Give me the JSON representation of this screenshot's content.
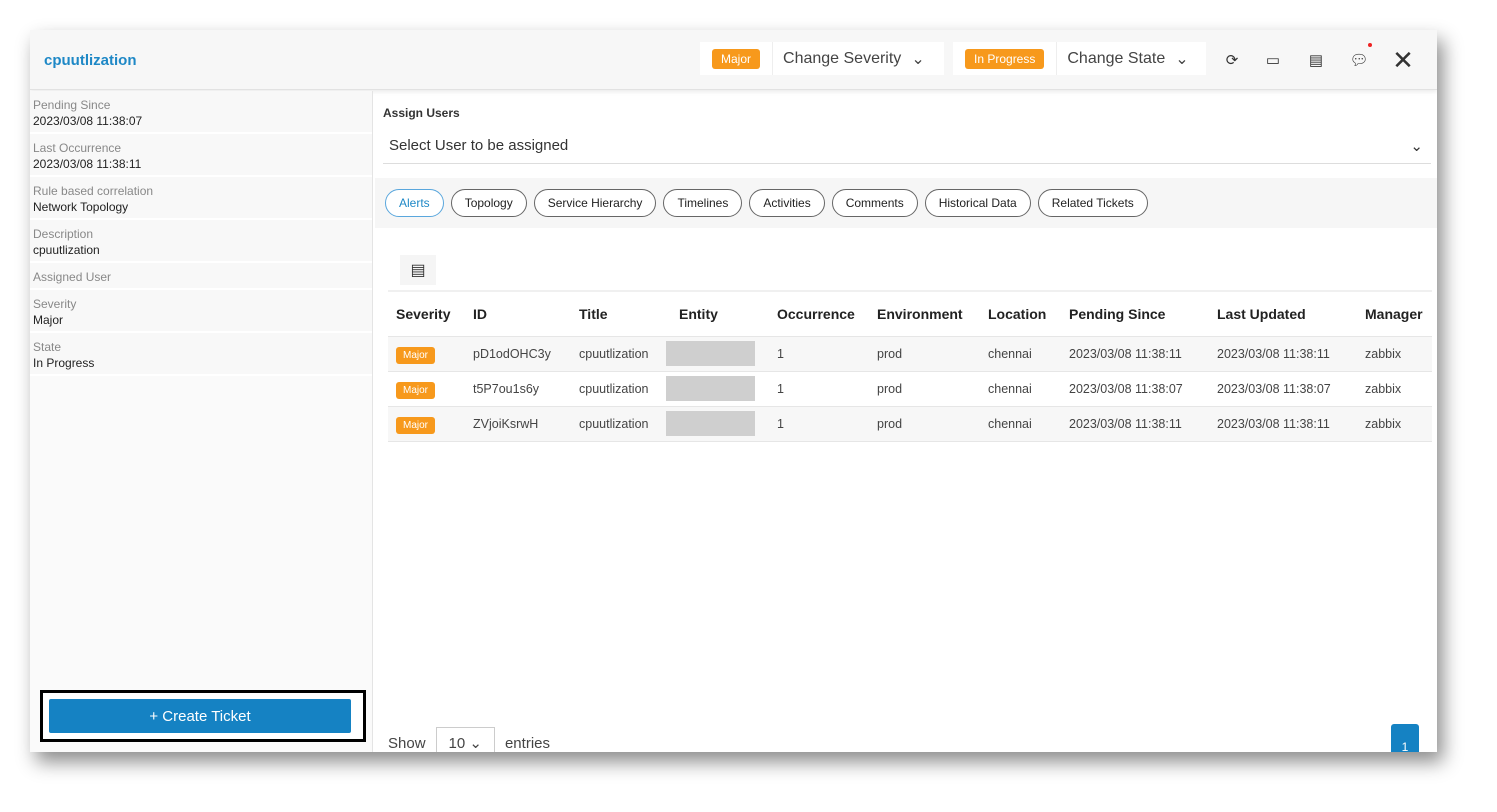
{
  "header": {
    "title": "cpuutlization",
    "severity_badge": "Major",
    "change_severity": "Change Severity",
    "state_badge": "In Progress",
    "change_state": "Change State"
  },
  "sidebar": {
    "fields": [
      {
        "label": "Pending Since",
        "value": "2023/03/08 11:38:07"
      },
      {
        "label": "Last Occurrence",
        "value": "2023/03/08 11:38:11"
      },
      {
        "label": "Rule based correlation",
        "value": "Network Topology"
      },
      {
        "label": "Description",
        "value": "cpuutlization"
      },
      {
        "label": "Assigned User",
        "value": ""
      },
      {
        "label": "Severity",
        "value": "Major"
      },
      {
        "label": "State",
        "value": "In Progress"
      }
    ],
    "create_ticket": "+ Create Ticket"
  },
  "assign": {
    "label": "Assign Users",
    "placeholder": "Select User to be assigned"
  },
  "tabs": [
    "Alerts",
    "Topology",
    "Service Hierarchy",
    "Timelines",
    "Activities",
    "Comments",
    "Historical Data",
    "Related Tickets"
  ],
  "table": {
    "columns": [
      "Severity",
      "ID",
      "Title",
      "Entity",
      "Occurrence",
      "Environment",
      "Location",
      "Pending Since",
      "Last Updated",
      "Manager"
    ],
    "rows": [
      [
        "Major",
        "pD1odOHC3y",
        "cpuutlization",
        "",
        "1",
        "prod",
        "chennai",
        "2023/03/08 11:38:11",
        "2023/03/08 11:38:11",
        "zabbix"
      ],
      [
        "Major",
        "t5P7ou1s6y",
        "cpuutlization",
        "",
        "1",
        "prod",
        "chennai",
        "2023/03/08 11:38:07",
        "2023/03/08 11:38:07",
        "zabbix"
      ],
      [
        "Major",
        "ZVjoiKsrwH",
        "cpuutlization",
        "",
        "1",
        "prod",
        "chennai",
        "2023/03/08 11:38:11",
        "2023/03/08 11:38:11",
        "zabbix"
      ]
    ]
  },
  "footer": {
    "show": "Show",
    "page_size": "10",
    "entries": "entries",
    "page": "1"
  }
}
